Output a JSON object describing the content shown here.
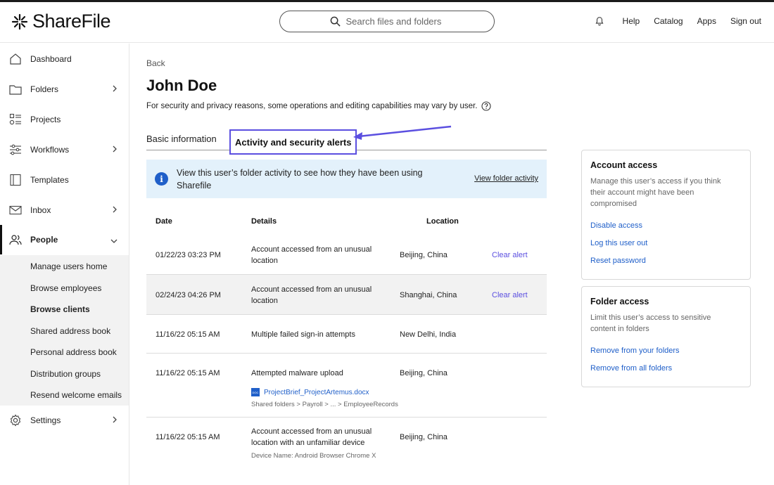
{
  "app": {
    "name": "ShareFile"
  },
  "header": {
    "search_placeholder": "Search files and folders",
    "links": [
      "Help",
      "Catalog",
      "Apps",
      "Sign out"
    ]
  },
  "sidebar": {
    "items": [
      {
        "label": "Dashboard",
        "icon": "home-icon"
      },
      {
        "label": "Folders",
        "icon": "folder-icon"
      },
      {
        "label": "Projects",
        "icon": "projects-icon"
      },
      {
        "label": "Workflows",
        "icon": "workflow-icon"
      },
      {
        "label": "Templates",
        "icon": "template-icon"
      },
      {
        "label": "Inbox",
        "icon": "mail-icon"
      },
      {
        "label": "People",
        "icon": "people-icon"
      },
      {
        "label": "Settings",
        "icon": "gear-icon"
      }
    ],
    "people_sub": [
      "Manage users home",
      "Browse employees",
      "Browse clients",
      "Shared address book",
      "Personal address book",
      "Distribution groups",
      "Resend welcome emails"
    ]
  },
  "page": {
    "back": "Back",
    "title": "John Doe",
    "note": "For security and privacy reasons, some operations and editing capabilities may vary by user.",
    "tabs": [
      "Basic information",
      "Activity and security alerts"
    ]
  },
  "banner": {
    "text": "View this user’s folder activity to see how they have been using Sharefile",
    "link": "View folder activity"
  },
  "table": {
    "headers": [
      "Date",
      "Details",
      "Location"
    ],
    "rows": [
      {
        "date": "01/22/23 03:23 PM",
        "details": "Account accessed from an unusual location",
        "location": "Beijing, China",
        "action": "Clear alert"
      },
      {
        "date": "02/24/23 04:26 PM",
        "details": "Account accessed from an unusual location",
        "location": "Shanghai, China",
        "action": "Clear alert"
      },
      {
        "date": "11/16/22 05:15 AM",
        "details": "Multiple failed sign-in attempts",
        "location": "New Delhi, India"
      },
      {
        "date": "11/16/22 05:15 AM",
        "details": "Attempted malware upload",
        "location": "Beijing, China",
        "file": "ProjectBrief_ProjectArtemus.docx",
        "file_badge": "DOC",
        "path": "Shared folders > Payroll > ... > EmployeeRecords"
      },
      {
        "date": "11/16/22 05:15 AM",
        "details": "Account accessed from an unusual location with an unfamiliar device",
        "location": "Beijing, China",
        "meta": "Device Name: Android Browser Chrome X"
      }
    ]
  },
  "account_access": {
    "title": "Account access",
    "desc": "Manage this user’s access if you think their account might have been compromised",
    "actions": [
      "Disable access",
      "Log this user out",
      "Reset password"
    ]
  },
  "folder_access": {
    "title": "Folder access",
    "desc": "Limit this user’s access to sensitive content in folders",
    "actions": [
      "Remove from your folders",
      "Remove from all folders"
    ]
  },
  "colors": {
    "accent": "#5b4fe0",
    "link": "#1f5fc9",
    "banner_bg": "#e3f1fb"
  }
}
